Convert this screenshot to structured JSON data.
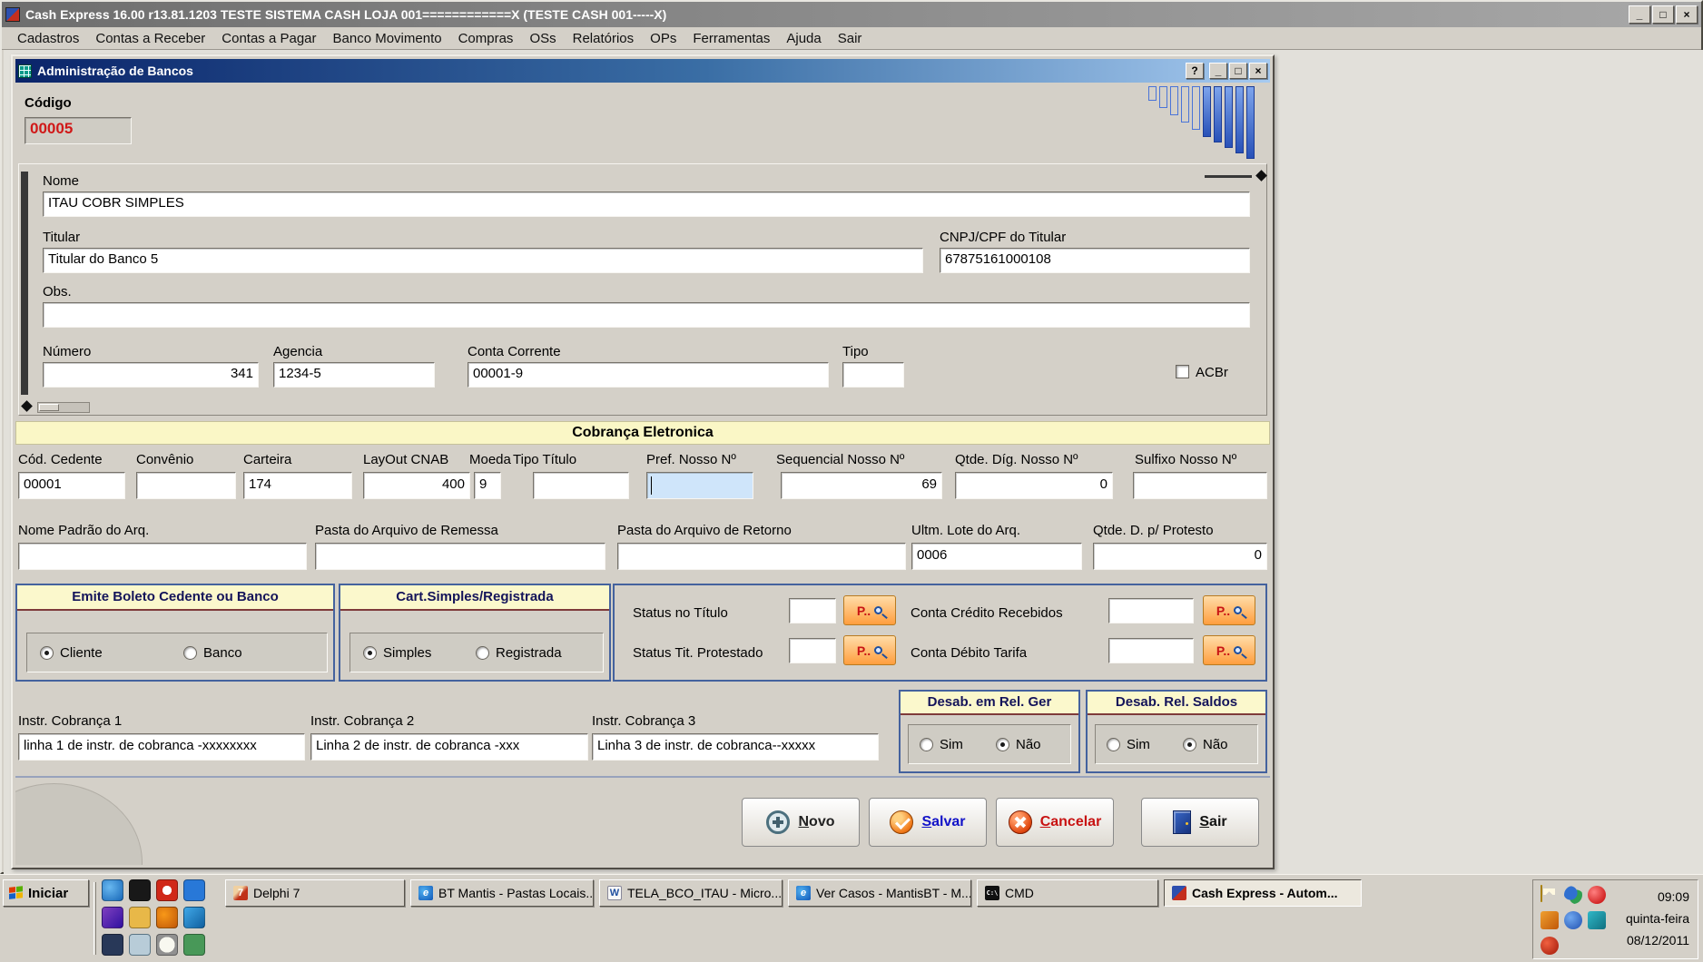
{
  "window": {
    "title": "Cash Express 16.00 r13.81.1203   TESTE SISTEMA CASH LOJA 001============X (TESTE CASH 001-----X)",
    "controls": {
      "minimize": "_",
      "maximize": "□",
      "close": "×",
      "help": "?"
    }
  },
  "menu": {
    "items": [
      "Cadastros",
      "Contas a Receber",
      "Contas a Pagar",
      "Banco Movimento",
      "Compras",
      "OSs",
      "Relatórios",
      "OPs",
      "Ferramentas",
      "Ajuda",
      "Sair"
    ]
  },
  "dialog": {
    "title": "Administração de Bancos",
    "lookup_button": "P..",
    "codigo": {
      "label": "Código",
      "value": "00005"
    },
    "info": {
      "nome": {
        "label": "Nome",
        "value": "ITAU COBR SIMPLES"
      },
      "titular": {
        "label": "Titular",
        "value": "Titular do Banco 5"
      },
      "cnpj": {
        "label": "CNPJ/CPF do Titular",
        "value": "67875161000108"
      },
      "obs": {
        "label": "Obs.",
        "value": ""
      },
      "numero": {
        "label": "Número",
        "value": "341"
      },
      "agencia": {
        "label": "Agencia",
        "value": "1234-5"
      },
      "conta": {
        "label": "Conta Corrente",
        "value": "00001-9"
      },
      "tipo": {
        "label": "Tipo",
        "value": ""
      },
      "acbr": {
        "label": "ACBr",
        "checked": false
      }
    },
    "section_title": "Cobrança Eletronica",
    "cobranca": {
      "cod_cedente": {
        "label": "Cód. Cedente",
        "value": "00001"
      },
      "convenio": {
        "label": "Convênio",
        "value": ""
      },
      "carteira": {
        "label": "Carteira",
        "value": "174"
      },
      "layout_cnab": {
        "label": "LayOut CNAB",
        "value": "400"
      },
      "moeda": {
        "label": "Moeda",
        "value": "9"
      },
      "tipo_titulo": {
        "label": "Tipo Título",
        "value": ""
      },
      "pref_nosso": {
        "label": "Pref. Nosso Nº",
        "value": ""
      },
      "seq_nosso": {
        "label": "Sequencial Nosso Nº",
        "value": "69"
      },
      "qtde_dig": {
        "label": "Qtde. Díg. Nosso Nº",
        "value": "0"
      },
      "sulfixo": {
        "label": "Sulfixo Nosso Nº",
        "value": ""
      },
      "nome_padrao": {
        "label": "Nome Padrão do Arq.",
        "value": ""
      },
      "pasta_remessa": {
        "label": "Pasta do Arquivo de Remessa",
        "value": ""
      },
      "pasta_retorno": {
        "label": "Pasta do Arquivo de Retorno",
        "value": ""
      },
      "ultm_lote": {
        "label": "Ultm. Lote do Arq.",
        "value": "0006"
      },
      "qtde_protesto": {
        "label": "Qtde. D. p/ Protesto",
        "value": "0"
      }
    },
    "groups": {
      "emite": {
        "title": "Emite Boleto Cedente ou Banco",
        "options": [
          "Cliente",
          "Banco"
        ],
        "selected": "Cliente"
      },
      "cart": {
        "title": "Cart.Simples/Registrada",
        "options": [
          "Simples",
          "Registrada"
        ],
        "selected": "Simples"
      },
      "desab_rel": {
        "title": "Desab. em Rel. Ger",
        "options": [
          "Sim",
          "Não"
        ],
        "selected": "Não"
      },
      "desab_saldos": {
        "title": "Desab. Rel. Saldos",
        "options": [
          "Sim",
          "Não"
        ],
        "selected": "Não"
      }
    },
    "status": {
      "status_titulo": {
        "label": "Status no Título",
        "value": ""
      },
      "conta_credito": {
        "label": "Conta Crédito Recebidos",
        "value": ""
      },
      "status_protestado": {
        "label": "Status Tit. Protestado",
        "value": ""
      },
      "conta_debito": {
        "label": "Conta Débito Tarifa",
        "value": ""
      }
    },
    "instr": {
      "i1": {
        "label": "Instr. Cobrança 1",
        "value": "linha 1 de instr. de cobranca -xxxxxxxx"
      },
      "i2": {
        "label": "Instr. Cobrança 2",
        "value": "Linha 2 de instr. de cobranca -xxx"
      },
      "i3": {
        "label": "Instr. Cobrança 3",
        "value": "Linha 3 de instr. de cobranca--xxxxx"
      }
    },
    "buttons": {
      "novo": "Novo",
      "salvar": "Salvar",
      "cancelar": "Cancelar",
      "sair": "Sair"
    }
  },
  "icons": {
    "ie": "e",
    "word": "W",
    "cmd": "C:\\",
    "delphi": "7"
  },
  "taskbar": {
    "start_label": "Iniciar",
    "tasks": [
      {
        "label": "Delphi 7"
      },
      {
        "label": "BT Mantis - Pastas Locais..."
      },
      {
        "label": "TELA_BCO_ITAU - Micro..."
      },
      {
        "label": "Ver Casos - MantisBT - M..."
      },
      {
        "label": "CMD"
      },
      {
        "label": "Cash Express - Autom..."
      }
    ],
    "clock": {
      "time": "09:09",
      "weekday": "quinta-feira",
      "date": "08/12/2011"
    }
  }
}
